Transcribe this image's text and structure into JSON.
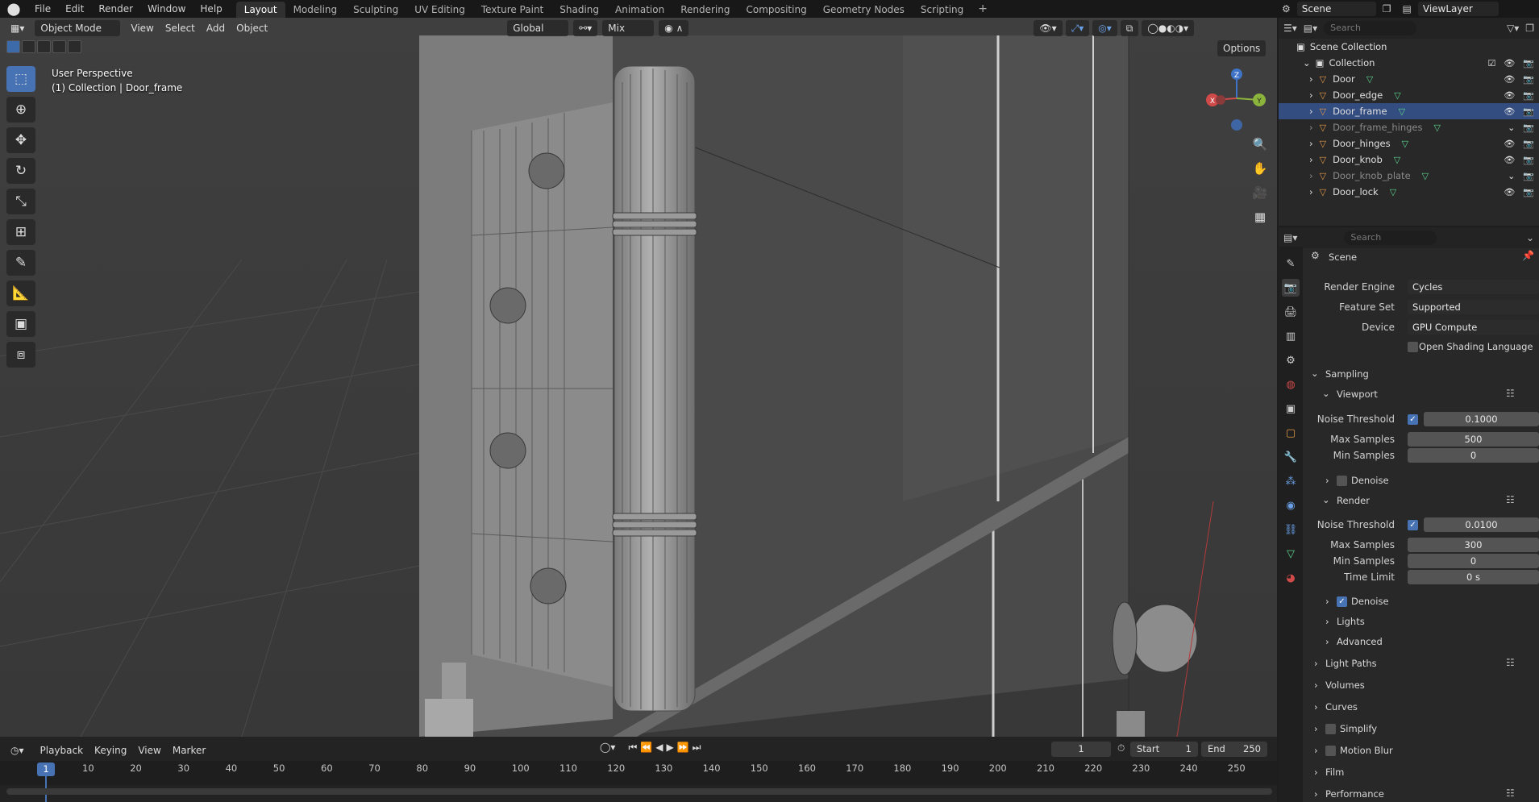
{
  "topbar": {
    "menus": [
      "File",
      "Edit",
      "Render",
      "Window",
      "Help"
    ],
    "workspaces": [
      "Layout",
      "Modeling",
      "Sculpting",
      "UV Editing",
      "Texture Paint",
      "Shading",
      "Animation",
      "Rendering",
      "Compositing",
      "Geometry Nodes",
      "Scripting"
    ],
    "active_workspace": "Layout",
    "add_tab": "+",
    "scene": "Scene",
    "view_layer": "ViewLayer"
  },
  "viewport": {
    "mode": "Object Mode",
    "menus": [
      "View",
      "Select",
      "Add",
      "Object"
    ],
    "transform_orientation": "Global",
    "snap_mode": "Mix",
    "options": "Options",
    "perspective": "User Perspective",
    "context": "(1) Collection | Door_frame",
    "gizmo": {
      "x": "X",
      "y": "Y",
      "z": "Z"
    }
  },
  "outliner": {
    "search_placeholder": "Search",
    "scene_collection": "Scene Collection",
    "collection": "Collection",
    "objects": [
      {
        "name": "Door"
      },
      {
        "name": "Door_edge"
      },
      {
        "name": "Door_frame"
      },
      {
        "name": "Door_frame_hinges"
      },
      {
        "name": "Door_hinges"
      },
      {
        "name": "Door_knob"
      },
      {
        "name": "Door_knob_plate"
      },
      {
        "name": "Door_lock"
      }
    ],
    "selected": "Door_frame"
  },
  "properties": {
    "search_placeholder": "Search",
    "context_title": "Scene",
    "render_engine_label": "Render Engine",
    "render_engine": "Cycles",
    "feature_set_label": "Feature Set",
    "feature_set": "Supported",
    "device_label": "Device",
    "device": "GPU Compute",
    "osl_label": "Open Shading Language",
    "sampling": "Sampling",
    "viewport": "Viewport",
    "vp_noise_label": "Noise Threshold",
    "vp_noise": "0.1000",
    "vp_max_label": "Max Samples",
    "vp_max": "500",
    "vp_min_label": "Min Samples",
    "vp_min": "0",
    "denoise": "Denoise",
    "render": "Render",
    "r_noise_label": "Noise Threshold",
    "r_noise": "0.0100",
    "r_max_label": "Max Samples",
    "r_max": "300",
    "r_min_label": "Min Samples",
    "r_min": "0",
    "time_limit_label": "Time Limit",
    "time_limit": "0 s",
    "denoise2": "Denoise",
    "lights": "Lights",
    "advanced": "Advanced",
    "light_paths": "Light Paths",
    "volumes": "Volumes",
    "curves": "Curves",
    "simplify": "Simplify",
    "motion_blur": "Motion Blur",
    "film": "Film",
    "performance": "Performance"
  },
  "timeline": {
    "menus": [
      "Playback",
      "Keying",
      "View",
      "Marker"
    ],
    "current_frame": "1",
    "start_label": "Start",
    "start": "1",
    "end_label": "End",
    "end": "250",
    "ticks": [
      "10",
      "20",
      "30",
      "40",
      "50",
      "60",
      "70",
      "80",
      "90",
      "100",
      "110",
      "120",
      "130",
      "140",
      "150",
      "160",
      "170",
      "180",
      "190",
      "200",
      "210",
      "220",
      "230",
      "240",
      "250"
    ],
    "frame_marker": "1"
  }
}
